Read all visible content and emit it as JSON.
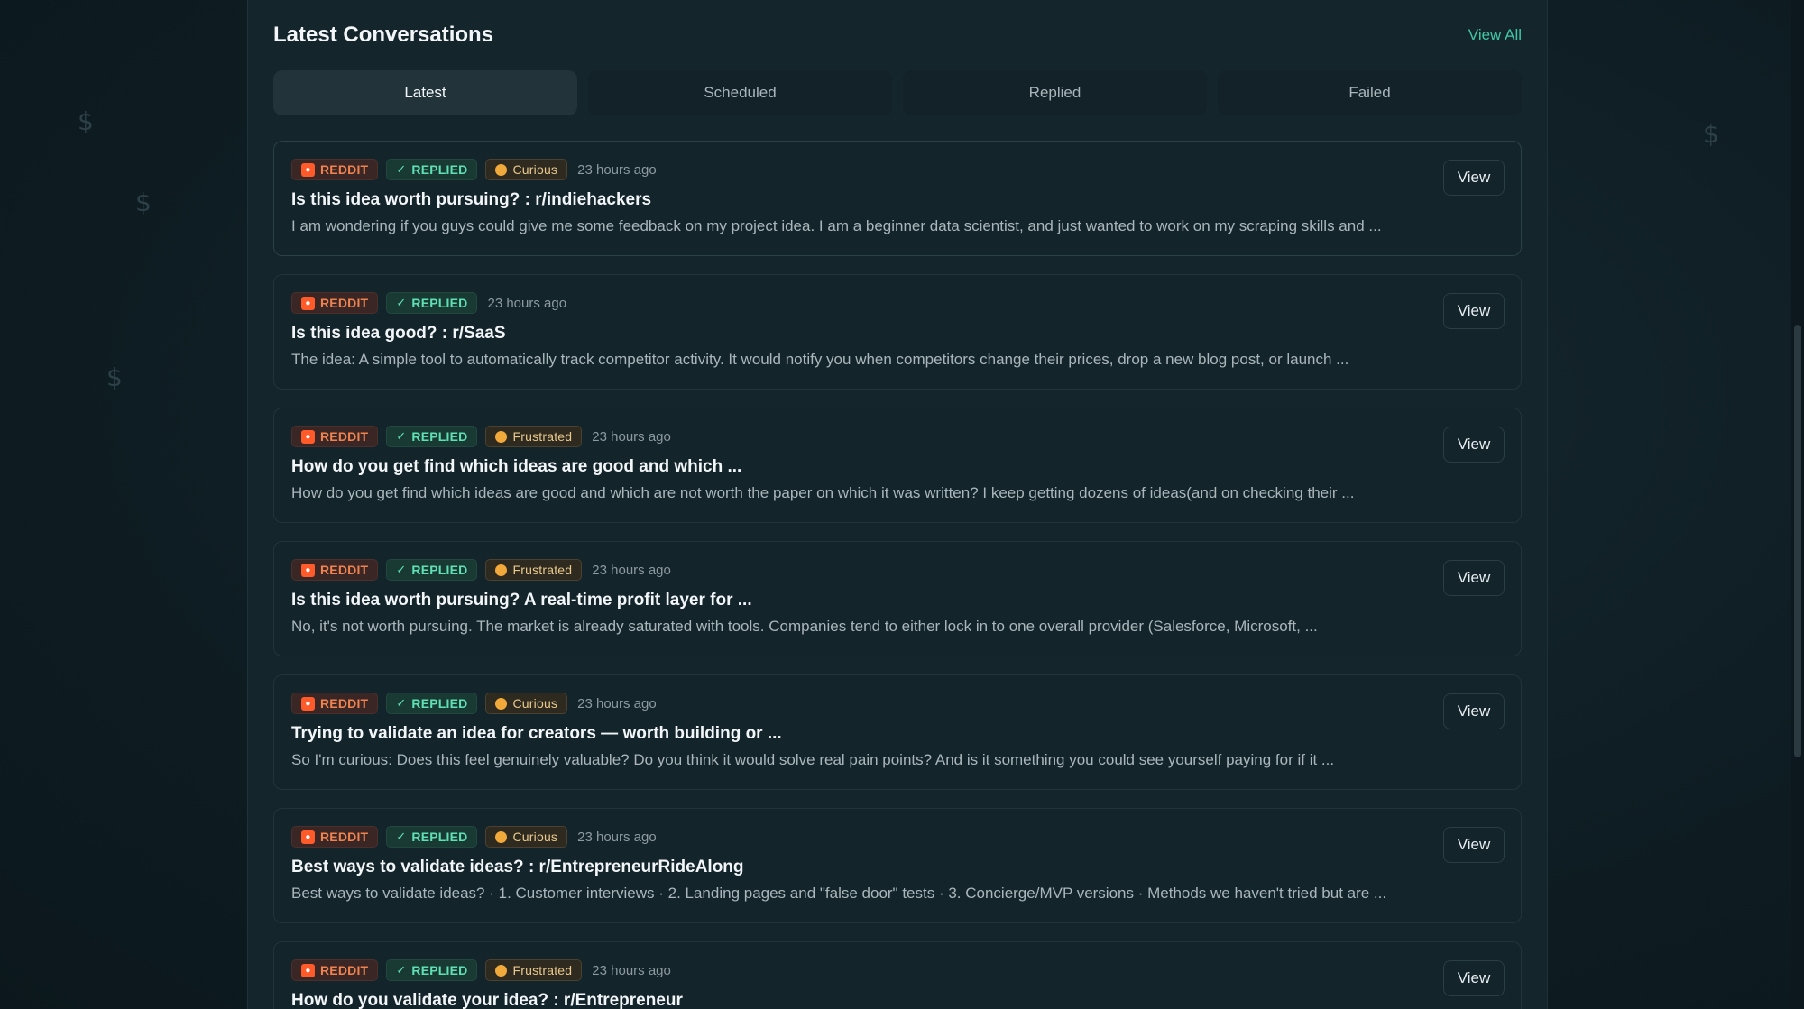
{
  "header": {
    "title": "Latest Conversations",
    "view_all": "View All"
  },
  "tabs": [
    {
      "label": "Latest",
      "active": true
    },
    {
      "label": "Scheduled",
      "active": false
    },
    {
      "label": "Replied",
      "active": false
    },
    {
      "label": "Failed",
      "active": false
    }
  ],
  "conversations": [
    {
      "source": "REDDIT",
      "status": "REPLIED",
      "emotion": "Curious",
      "time": "23 hours ago",
      "title": "Is this idea worth pursuing? : r/indiehackers",
      "excerpt": "I am wondering if you guys could give me some feedback on my project idea. I am a beginner data scientist, and just wanted to work on my scraping skills and ...",
      "action": "View"
    },
    {
      "source": "REDDIT",
      "status": "REPLIED",
      "emotion": "",
      "time": "23 hours ago",
      "title": "Is this idea good? : r/SaaS",
      "excerpt": "The idea: A simple tool to automatically track competitor activity. It would notify you when competitors change their prices, drop a new blog post, or launch ...",
      "action": "View"
    },
    {
      "source": "REDDIT",
      "status": "REPLIED",
      "emotion": "Frustrated",
      "time": "23 hours ago",
      "title": "How do you get find which ideas are good and which ...",
      "excerpt": "How do you get find which ideas are good and which are not worth the paper on which it was written? I keep getting dozens of ideas(and on checking their ...",
      "action": "View"
    },
    {
      "source": "REDDIT",
      "status": "REPLIED",
      "emotion": "Frustrated",
      "time": "23 hours ago",
      "title": "Is this idea worth pursuing? A real-time profit layer for ...",
      "excerpt": "No, it's not worth pursuing. The market is already saturated with tools. Companies tend to either lock in to one overall provider (Salesforce, Microsoft, ...",
      "action": "View"
    },
    {
      "source": "REDDIT",
      "status": "REPLIED",
      "emotion": "Curious",
      "time": "23 hours ago",
      "title": "Trying to validate an idea for creators — worth building or ...",
      "excerpt": "So I'm curious: Does this feel genuinely valuable? Do you think it would solve real pain points? And is it something you could see yourself paying for if it ...",
      "action": "View"
    },
    {
      "source": "REDDIT",
      "status": "REPLIED",
      "emotion": "Curious",
      "time": "23 hours ago",
      "title": "Best ways to validate ideas? : r/EntrepreneurRideAlong",
      "excerpt": "Best ways to validate ideas? · 1. Customer interviews · 2. Landing pages and \"false door\" tests · 3. Concierge/MVP versions · Methods we haven't tried but are ...",
      "action": "View"
    },
    {
      "source": "REDDIT",
      "status": "REPLIED",
      "emotion": "Frustrated",
      "time": "23 hours ago",
      "title": "How do you validate your idea? : r/Entrepreneur",
      "excerpt": "",
      "action": "View"
    }
  ],
  "icons": {
    "reddit": "reddit-icon",
    "check": "check-icon",
    "emotion": "emotion-icon",
    "background": "dollar-icon"
  },
  "colors": {
    "accent": "#3fc7a4",
    "reddit": "#f0834f",
    "replied": "#5fe0b4",
    "emotion": "#e9c98c"
  }
}
